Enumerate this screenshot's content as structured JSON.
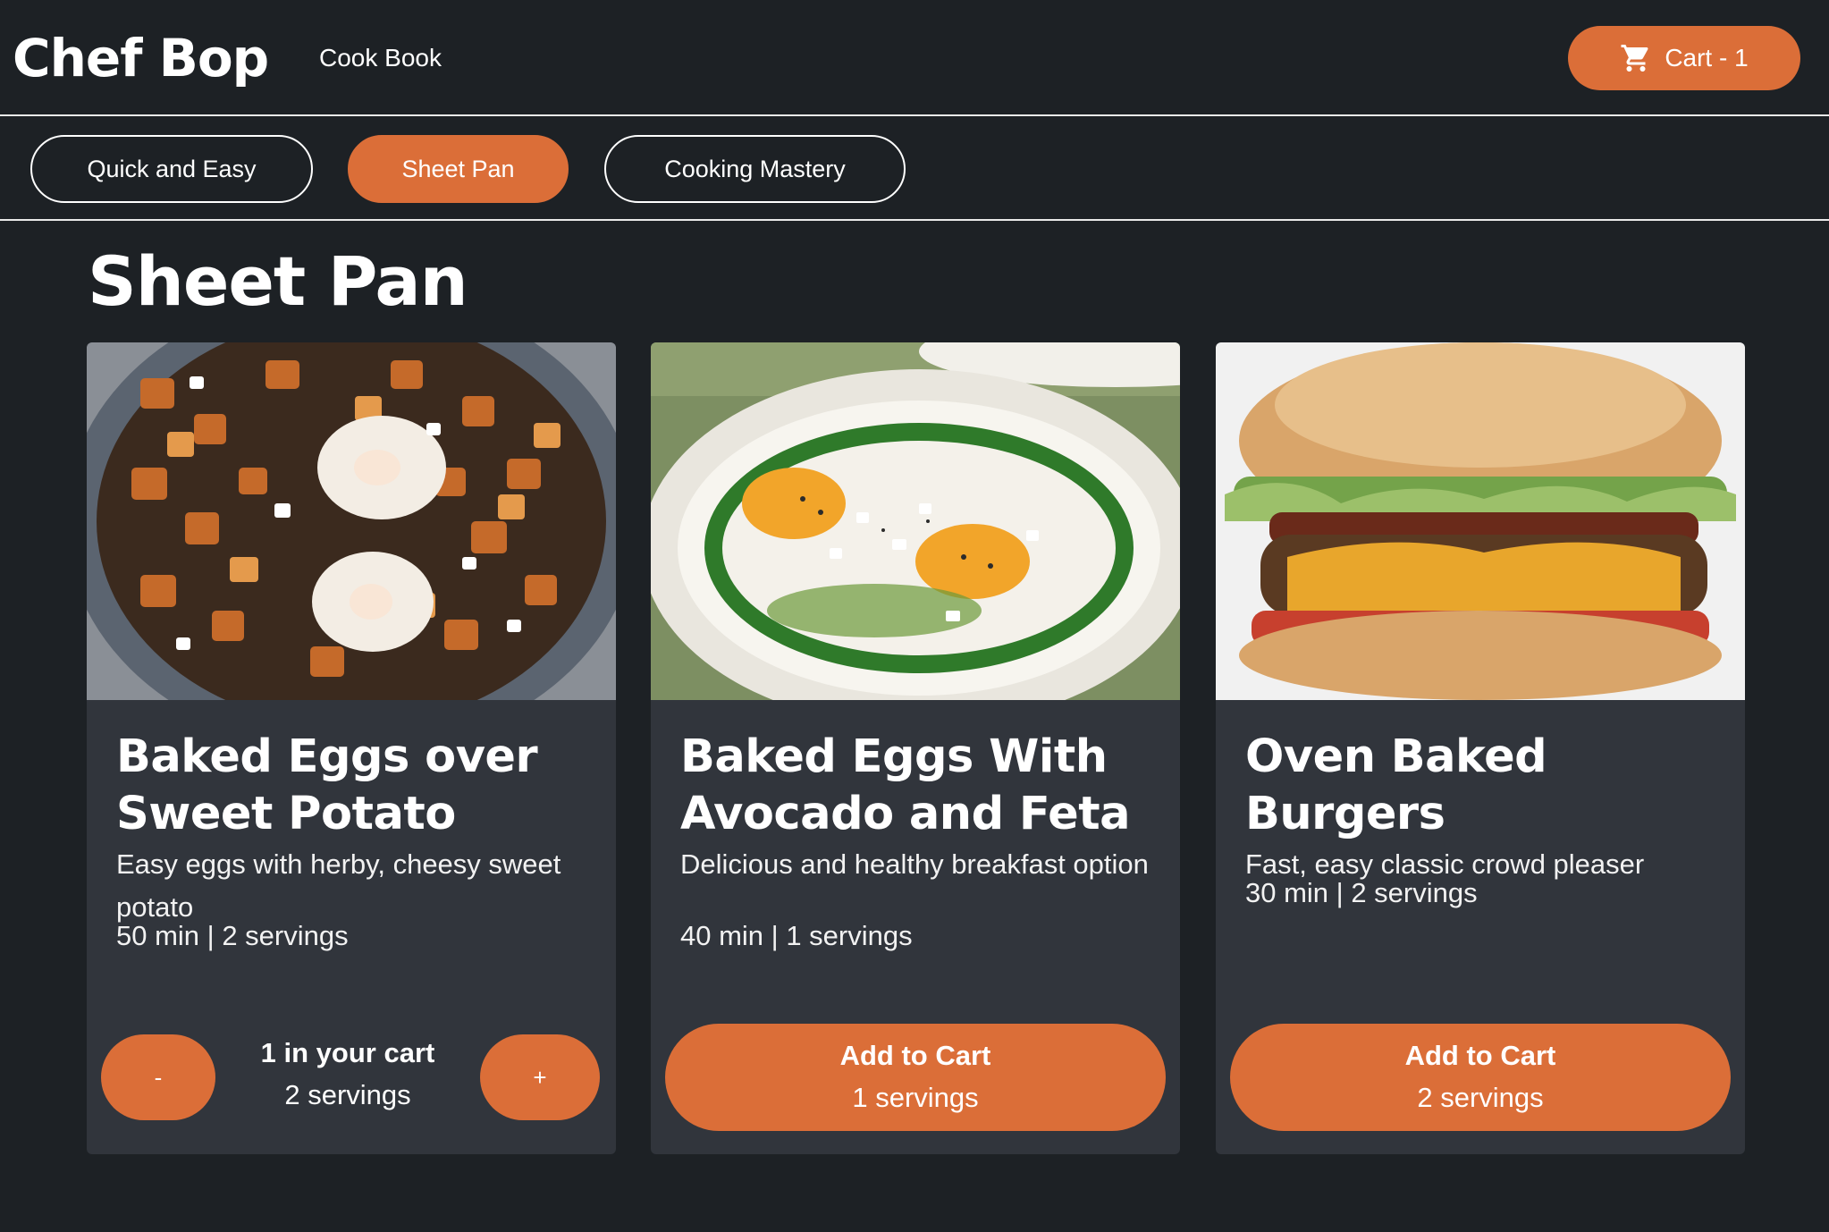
{
  "header": {
    "brand": "Chef Bop",
    "nav_cookbook": "Cook Book",
    "cart_label": "Cart - 1",
    "cart_icon": "shopping-cart-icon"
  },
  "tabs": [
    {
      "label": "Quick and Easy",
      "active": false
    },
    {
      "label": "Sheet Pan",
      "active": true
    },
    {
      "label": "Cooking Mastery",
      "active": false
    }
  ],
  "page": {
    "title": "Sheet Pan"
  },
  "recipes": [
    {
      "title": "Baked Eggs over Sweet Potato",
      "description": "Easy eggs with herby, cheesy sweet potato",
      "meta": "50 min | 2 servings",
      "in_cart": true,
      "minus_label": "-",
      "plus_label": "+",
      "cart_count_label": "1 in your cart",
      "servings_label": "2 servings"
    },
    {
      "title": "Baked Eggs With Avocado and Feta",
      "description": "Delicious and healthy breakfast option",
      "meta": "40 min | 1 servings",
      "in_cart": false,
      "add_label": "Add to Cart",
      "servings_label": "1 servings"
    },
    {
      "title": "Oven Baked Burgers",
      "description": "Fast, easy classic crowd pleaser",
      "meta": "30 min | 2 servings",
      "in_cart": false,
      "add_label": "Add to Cart",
      "servings_label": "2 servings"
    }
  ],
  "colors": {
    "background": "#1d2125",
    "card": "#31353c",
    "accent": "#db6e38",
    "text": "#ffffff"
  }
}
